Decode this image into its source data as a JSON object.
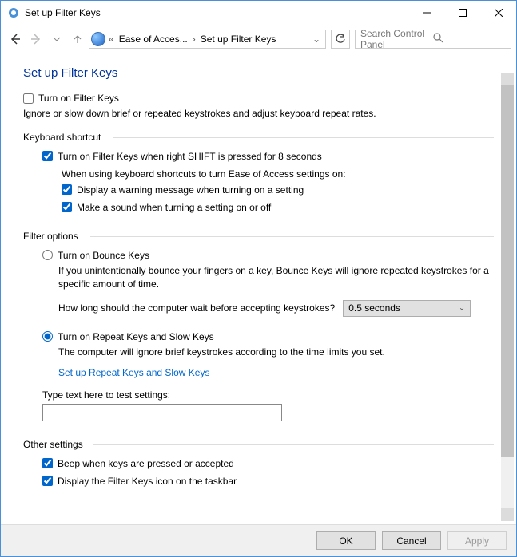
{
  "window": {
    "title": "Set up Filter Keys"
  },
  "nav": {
    "crumb_chevrons": "«",
    "crumb1": "Ease of Acces...",
    "crumb2": "Set up Filter Keys",
    "search_placeholder": "Search Control Panel"
  },
  "page": {
    "title": "Set up Filter Keys",
    "turn_on_label": "Turn on Filter Keys",
    "turn_on_checked": false,
    "ignore_help": "Ignore or slow down brief or repeated keystrokes and adjust keyboard repeat rates."
  },
  "shortcut": {
    "section_label": "Keyboard shortcut",
    "right_shift_label": "Turn on Filter Keys when right SHIFT is pressed for 8 seconds",
    "right_shift_checked": true,
    "when_using": "When using keyboard shortcuts to turn Ease of Access settings on:",
    "warning_label": "Display a warning message when turning on a setting",
    "warning_checked": true,
    "sound_label": "Make a sound when turning a setting on or off",
    "sound_checked": true
  },
  "filter": {
    "section_label": "Filter options",
    "bounce_label": "Turn on Bounce Keys",
    "bounce_selected": false,
    "bounce_help": "If you unintentionally bounce your fingers on a key, Bounce Keys will ignore repeated keystrokes for a specific amount of time.",
    "wait_q": "How long should the computer wait before accepting keystrokes?",
    "wait_value": "0.5 seconds",
    "repeat_label": "Turn on Repeat Keys and Slow Keys",
    "repeat_selected": true,
    "repeat_help": "The computer will ignore brief keystrokes according to the time limits you set.",
    "link_label": "Set up Repeat Keys and Slow Keys",
    "test_label": "Type text here to test settings:"
  },
  "other": {
    "section_label": "Other settings",
    "beep_label": "Beep when keys are pressed or accepted",
    "beep_checked": true,
    "taskbar_label": "Display the Filter Keys icon on the taskbar",
    "taskbar_checked": true
  },
  "buttons": {
    "ok": "OK",
    "cancel": "Cancel",
    "apply": "Apply"
  }
}
